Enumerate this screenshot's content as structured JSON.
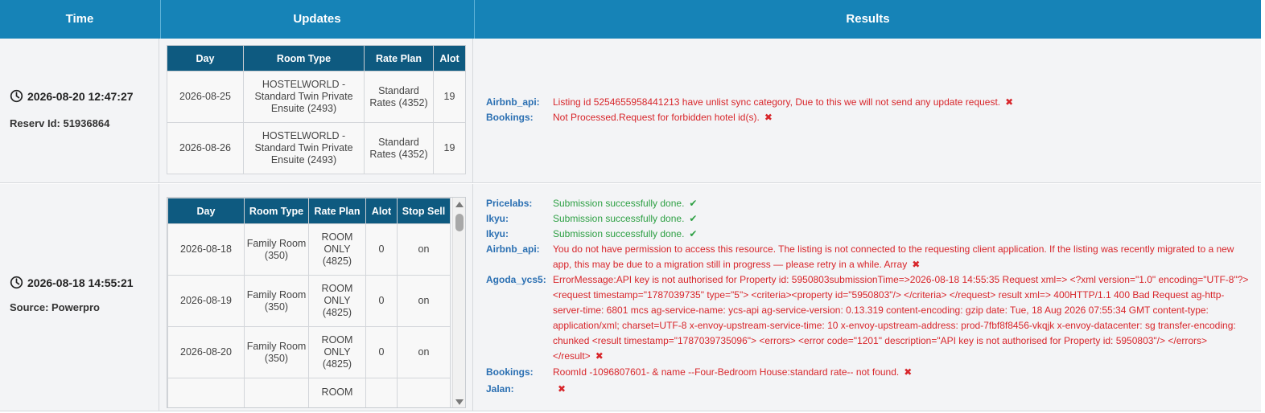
{
  "header": {
    "time": "Time",
    "updates": "Updates",
    "results": "Results"
  },
  "rows": [
    {
      "datetime": "2026-08-20 12:47:27",
      "sub": "Reserv Id: 51936864",
      "table": {
        "columns": [
          "Day",
          "Room Type",
          "Rate Plan",
          "Alot"
        ],
        "rows": [
          [
            "2026-08-25",
            "HOSTELWORLD - Standard Twin Private Ensuite (2493)",
            "Standard Rates (4352)",
            "19"
          ],
          [
            "2026-08-26",
            "HOSTELWORLD - Standard Twin Private Ensuite (2493)",
            "Standard Rates (4352)",
            "19"
          ]
        ]
      },
      "results": [
        {
          "label": "Airbnb_api:",
          "message": "Listing id 5254655958441213 have unlist sync category, Due to this we will not send any update request.",
          "status": "error"
        },
        {
          "label": "Bookings:",
          "message": "Not Processed.Request for forbidden hotel id(s).",
          "status": "error"
        }
      ]
    },
    {
      "datetime": "2026-08-18 14:55:21",
      "sub": "Source: Powerpro",
      "table": {
        "columns": [
          "Day",
          "Room Type",
          "Rate Plan",
          "Alot",
          "Stop Sell"
        ],
        "rows": [
          [
            "2026-08-18",
            "Family Room (350)",
            "ROOM ONLY (4825)",
            "0",
            "on"
          ],
          [
            "2026-08-19",
            "Family Room (350)",
            "ROOM ONLY (4825)",
            "0",
            "on"
          ],
          [
            "2026-08-20",
            "Family Room (350)",
            "ROOM ONLY (4825)",
            "0",
            "on"
          ],
          [
            "",
            "",
            "ROOM",
            "",
            ""
          ]
        ]
      },
      "results": [
        {
          "label": "Pricelabs:",
          "message": "Submission successfully done.",
          "status": "success"
        },
        {
          "label": "Ikyu:",
          "message": "Submission successfully done.",
          "status": "success"
        },
        {
          "label": "Ikyu:",
          "message": "Submission successfully done.",
          "status": "success"
        },
        {
          "label": "Airbnb_api:",
          "message": "You do not have permission to access this resource. The listing is not connected to the requesting client application. If the listing was recently migrated to a new app, this may be due to a migration still in progress — please retry in a while. Array",
          "status": "error"
        },
        {
          "label": "Agoda_ycs5:",
          "message": "ErrorMessage:API key is not authorised for Property id: 5950803submissionTime=>2026-08-18 14:55:35 Request xml=> <?xml version=\"1.0\" encoding=\"UTF-8\"?> <request timestamp=\"1787039735\" type=\"5\"> <criteria><property id=\"5950803\"/> </criteria> </request> result xml=> 400HTTP/1.1 400 Bad Request ag-http-server-time: 6801 mcs ag-service-name: ycs-api ag-service-version: 0.13.319 content-encoding: gzip date: Tue, 18 Aug 2026 07:55:34 GMT content-type: application/xml; charset=UTF-8 x-envoy-upstream-service-time: 10 x-envoy-upstream-address: prod-7fbf8f8456-vkqjk x-envoy-datacenter: sg transfer-encoding: chunked <result timestamp=\"1787039735096\"> <errors> <error code=\"1201\" description=\"API key is not authorised for Property id: 5950803\"/> </errors> </result>",
          "status": "error"
        },
        {
          "label": "Bookings:",
          "message": "RoomId -1096807601- & name --Four-Bedroom House:standard rate-- not found.",
          "status": "error"
        },
        {
          "label": "Jalan:",
          "message": "",
          "status": "error"
        }
      ]
    }
  ],
  "icons": {
    "time": "clock-icon",
    "error": "cross-icon",
    "success": "check-icon",
    "scroll_up": "arrow-up-icon",
    "scroll_down": "arrow-down-icon"
  },
  "colors": {
    "header": "#1683b7",
    "table_header": "#0e5a80",
    "label": "#2a6fb2",
    "error": "#d8262b",
    "success": "#2ea044"
  }
}
